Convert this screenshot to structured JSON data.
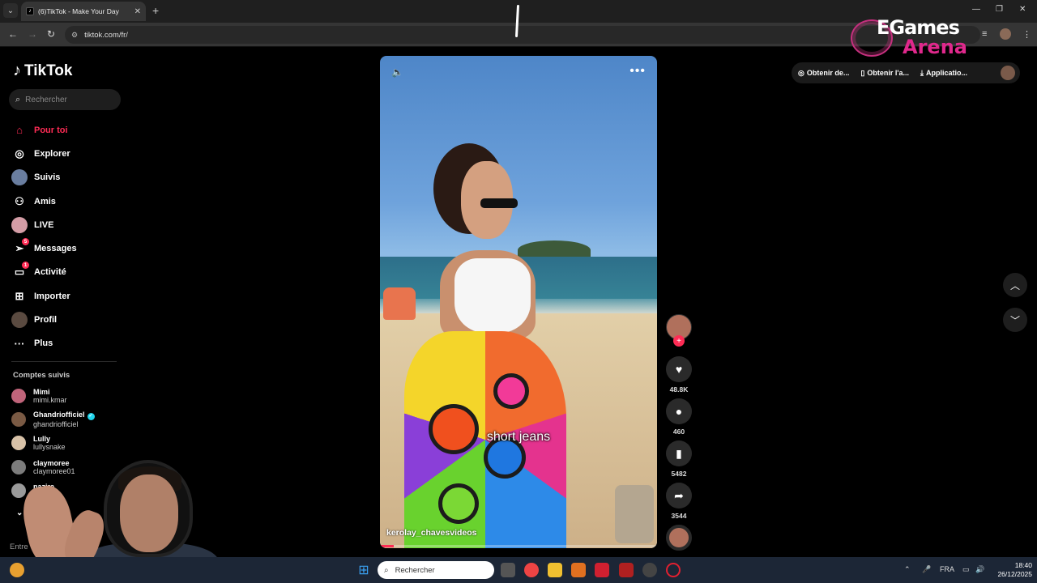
{
  "browser": {
    "tab_title": "(6)TikTok - Make Your Day",
    "url": "tiktok.com/fr/"
  },
  "watermark": {
    "line1": "EGames",
    "line2": "Arena"
  },
  "tiktok": {
    "logo": "TikTok",
    "search_placeholder": "Rechercher",
    "nav": [
      {
        "label": "Pour toi",
        "icon": "home-icon",
        "active": true
      },
      {
        "label": "Explorer",
        "icon": "compass-icon"
      },
      {
        "label": "Suivis",
        "icon": "following-avatar-icon"
      },
      {
        "label": "Amis",
        "icon": "friends-icon"
      },
      {
        "label": "LIVE",
        "icon": "live-avatar-icon"
      },
      {
        "label": "Messages",
        "icon": "messages-icon",
        "badge": "5"
      },
      {
        "label": "Activité",
        "icon": "activity-icon",
        "badge": "1"
      },
      {
        "label": "Importer",
        "icon": "upload-icon"
      },
      {
        "label": "Profil",
        "icon": "profile-avatar-icon"
      },
      {
        "label": "Plus",
        "icon": "more-dots-icon"
      }
    ],
    "following_title": "Comptes suivis",
    "following": [
      {
        "name": "Mimi",
        "handle": "mimi.kmar",
        "color": "#c0647a"
      },
      {
        "name": "Ghandriofficiel",
        "handle": "ghandriofficiel",
        "color": "#7a5a44",
        "verified": true
      },
      {
        "name": "Lully",
        "handle": "lullysnake",
        "color": "#d8c2a8"
      },
      {
        "name": "claymoree",
        "handle": "claymoree01",
        "color": "#7c7c7c"
      },
      {
        "name": "nazire",
        "handle": "nazir",
        "color": "#9a9a9a"
      }
    ],
    "voir_plus": "plus",
    "footer_partial": "Entre"
  },
  "video": {
    "caption": "short jeans",
    "author": "kerolay_chavesvideos",
    "progress": 0.05
  },
  "actions": {
    "likes": "48.8K",
    "comments": "460",
    "saves": "5482",
    "shares": "3544"
  },
  "top_right": {
    "btn1": "Obtenir de...",
    "btn2": "Obtenir l'a...",
    "btn3": "Applicatio..."
  },
  "taskbar": {
    "search_placeholder": "Rechercher",
    "lang": "FRA",
    "time": "18:40",
    "date": "26/12/2025"
  },
  "colors": {
    "accent": "#fe2c55",
    "verified": "#20d5ec"
  }
}
